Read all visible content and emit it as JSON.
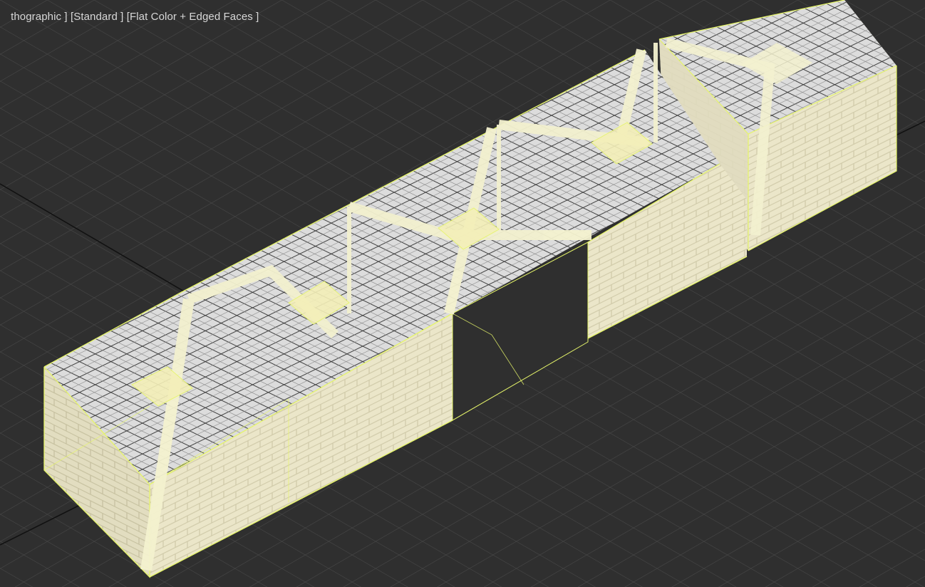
{
  "viewport": {
    "labels": {
      "view": "thographic",
      "shading_style": "Standard",
      "display_mode": "Flat Color + Edged Faces"
    },
    "colors": {
      "background": "#2f2f2f",
      "grid": "#4a4a4a",
      "grid_major": "#111111",
      "edge_highlight": "#e6f56a",
      "wall": "#ebe6c9",
      "wall_shadow": "#c9c4a6",
      "floor": "#d9d9d9",
      "timber": "#f3f1cf"
    },
    "objects": [
      "stone-wall-section",
      "floor-tile-slab",
      "timber-cross-brace",
      "door-opening"
    ]
  }
}
